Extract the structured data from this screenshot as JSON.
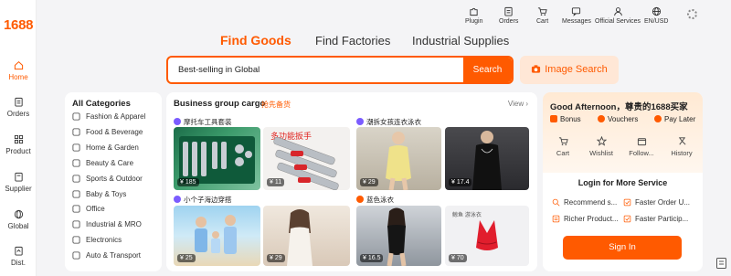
{
  "brand": {
    "logo": "1688",
    "accent": "#ff5a00"
  },
  "rail": [
    {
      "label": "Home",
      "icon": "home-icon",
      "active": true
    },
    {
      "label": "Orders",
      "icon": "clipboard-icon"
    },
    {
      "label": "Product",
      "icon": "grid-icon"
    },
    {
      "label": "Supplier",
      "icon": "store-icon"
    },
    {
      "label": "Global",
      "icon": "globe-icon"
    },
    {
      "label": "Dist.",
      "icon": "share-icon"
    }
  ],
  "topbar": [
    {
      "label": "Plugin",
      "icon": "puzzle-icon"
    },
    {
      "label": "Orders",
      "icon": "clipboard-icon"
    },
    {
      "label": "Cart",
      "icon": "cart-icon"
    },
    {
      "label": "Messages",
      "icon": "message-icon"
    },
    {
      "label": "Official Services",
      "icon": "user-icon"
    },
    {
      "label": "EN/USD",
      "icon": "globe-icon"
    }
  ],
  "search": {
    "tabs": [
      "Find Goods",
      "Find Factories",
      "Industrial Supplies"
    ],
    "value": "Best-selling in Global",
    "button": "Search",
    "image_search": "Image Search"
  },
  "categories": {
    "title": "All Categories",
    "items": [
      "Fashion & Apparel",
      "Food & Beverage",
      "Home & Garden",
      "Beauty & Care",
      "Sports & Outdoor",
      "Baby & Toys",
      "Office",
      "Industrial & MRO",
      "Electronics",
      "Auto & Transport"
    ]
  },
  "business": {
    "title": "Business group cargo",
    "subtitle": "抢先备货",
    "view": "View",
    "groups": [
      {
        "title": "摩托车工具套装",
        "prices": [
          "¥ 185",
          "¥ 11"
        ]
      },
      {
        "title": "潮拆女孩连衣泳衣",
        "prices": [
          "¥ 29",
          "¥ 17.4"
        ]
      },
      {
        "title": "小个子海边穿搭",
        "prices": [
          "¥ 25",
          "¥ 29"
        ]
      },
      {
        "title": "蓝色泳衣",
        "prices": [
          "¥ 16.5",
          "¥ 70"
        ]
      }
    ]
  },
  "side": {
    "greeting": "Good Afternoon，尊贵的1688买家",
    "perks": [
      "Bonus",
      "Vouchers",
      "Pay Later"
    ],
    "quick": [
      "Cart",
      "Wishlist",
      "Follow...",
      "History"
    ],
    "login_title": "Login for More Service",
    "features": [
      "Recommend s...",
      "Faster Order U...",
      "Richer Product...",
      "Faster Particip..."
    ],
    "signin": "Sign In"
  }
}
